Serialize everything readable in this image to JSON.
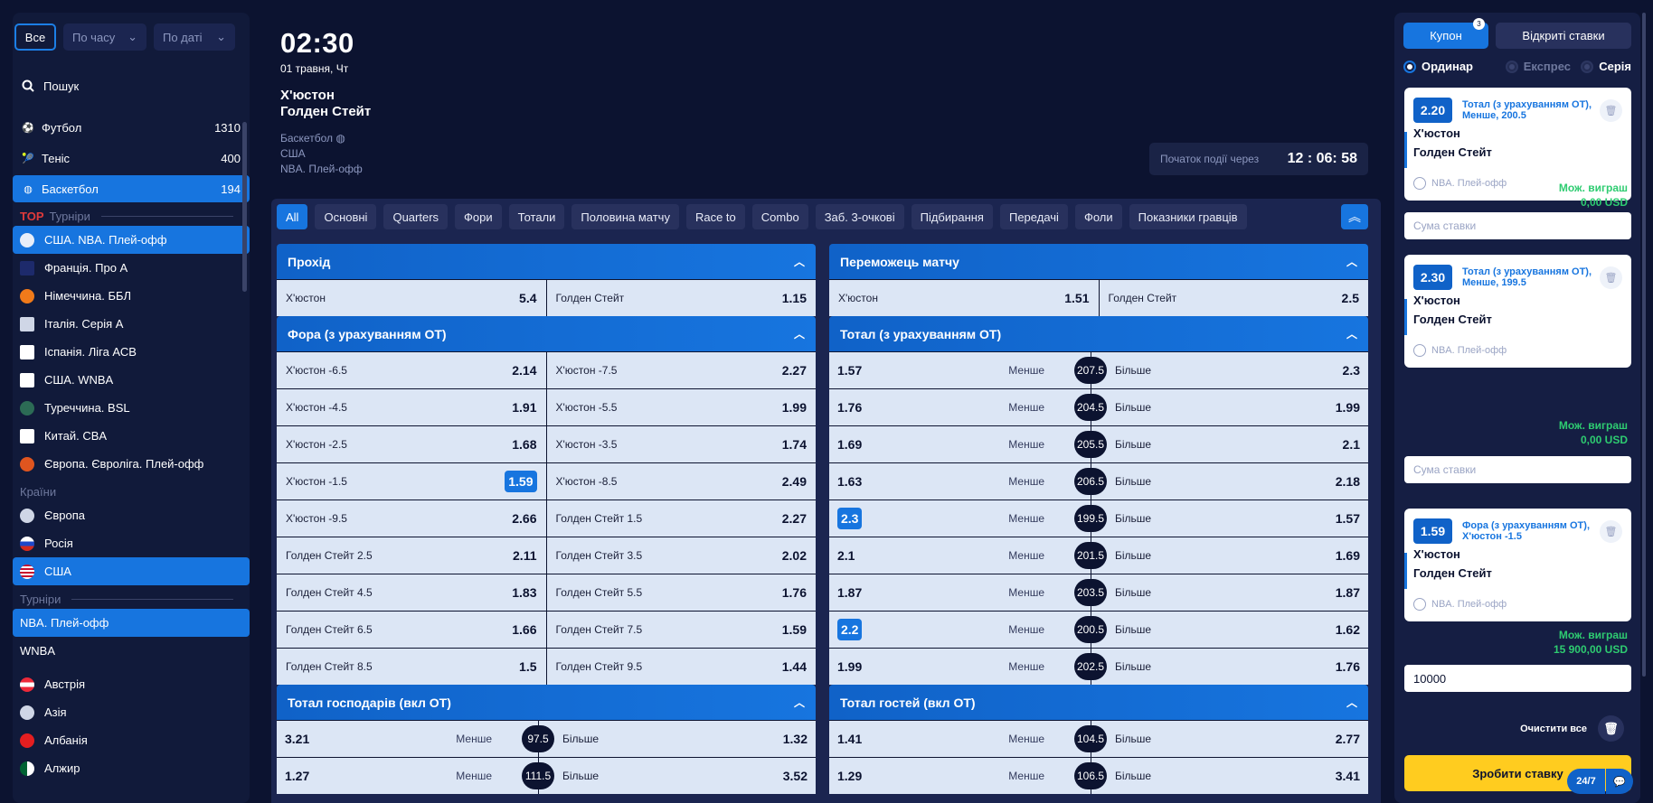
{
  "filters": {
    "all": "Все",
    "by_time": "По часу",
    "by_date": "По даті"
  },
  "search": {
    "label": "Пошук"
  },
  "sports": [
    {
      "icon": "football-icon",
      "name": "Футбол",
      "count": "1310"
    },
    {
      "icon": "tennis-icon",
      "name": "Теніс",
      "count": "400"
    },
    {
      "icon": "basketball-icon",
      "name": "Баскетбол",
      "count": "194"
    }
  ],
  "sections": {
    "top": "TOP",
    "tournaments": "Турніри",
    "countries": "Країни",
    "tournaments2": "Турніри"
  },
  "top_leagues": [
    "США. NBA. Плей-офф",
    "Франція. Про А",
    "Німеччина. ББЛ",
    "Італія. Серія А",
    "Іспанія. Ліга АСВ",
    "США. WNBA",
    "Туреччина. BSL",
    "Китай. CBA",
    "Європа. Євроліга. Плей-офф"
  ],
  "countries": [
    "Європа",
    "Росія",
    "США"
  ],
  "tournaments": [
    "NBA. Плей-офф",
    "WNBA"
  ],
  "other_countries": [
    "Австрія",
    "Азія",
    "Албанія",
    "Алжир"
  ],
  "event": {
    "time": "02:30",
    "date": "01 травня, Чт",
    "team1": "Х'юстон",
    "team2": "Голден Стейт",
    "sport": "Баскетбол",
    "country": "США",
    "league": "NBA. Плей-офф",
    "countdown_label": "Початок події через",
    "countdown": "12 : 06: 58"
  },
  "tabs": [
    "All",
    "Основні",
    "Quarters",
    "Фори",
    "Тотали",
    "Половина матчу",
    "Race to",
    "Combo",
    "Заб. 3-очкові",
    "Підбирання",
    "Передачі",
    "Фоли",
    "Показники гравців"
  ],
  "markets": {
    "prohid": {
      "title": "Прохід",
      "rows": [
        [
          "Х'юстон",
          "5.4",
          "Голден Стейт",
          "1.15"
        ]
      ]
    },
    "winner": {
      "title": "Переможець матчу",
      "rows": [
        [
          "Х'юстон",
          "1.51",
          "Голден Стейт",
          "2.5"
        ]
      ]
    },
    "handicap": {
      "title": "Фора (з урахуванням ОТ)",
      "rows": [
        [
          "Х'юстон -6.5",
          "2.14",
          "Х'юстон -7.5",
          "2.27"
        ],
        [
          "Х'юстон -4.5",
          "1.91",
          "Х'юстон -5.5",
          "1.99"
        ],
        [
          "Х'юстон -2.5",
          "1.68",
          "Х'юстон -3.5",
          "1.74"
        ],
        [
          "Х'юстон -1.5",
          "1.59",
          "Х'юстон -8.5",
          "2.49"
        ],
        [
          "Х'юстон -9.5",
          "2.66",
          "Голден Стейт 1.5",
          "2.27"
        ],
        [
          "Голден Стейт 2.5",
          "2.11",
          "Голден Стейт 3.5",
          "2.02"
        ],
        [
          "Голден Стейт 4.5",
          "1.83",
          "Голден Стейт 5.5",
          "1.76"
        ],
        [
          "Голден Стейт 6.5",
          "1.66",
          "Голден Стейт 7.5",
          "1.59"
        ],
        [
          "Голден Стейт 8.5",
          "1.5",
          "Голден Стейт 9.5",
          "1.44"
        ]
      ]
    },
    "total": {
      "title": "Тотал (з урахуванням ОТ)",
      "under": "Менше",
      "over": "Більше",
      "rows": [
        [
          "1.57",
          "207.5",
          "2.3"
        ],
        [
          "1.76",
          "204.5",
          "1.99"
        ],
        [
          "1.69",
          "205.5",
          "2.1"
        ],
        [
          "1.63",
          "206.5",
          "2.18"
        ],
        [
          "2.3",
          "199.5",
          "1.57"
        ],
        [
          "2.1",
          "201.5",
          "1.69"
        ],
        [
          "1.87",
          "203.5",
          "1.87"
        ],
        [
          "2.2",
          "200.5",
          "1.62"
        ],
        [
          "1.99",
          "202.5",
          "1.76"
        ]
      ]
    },
    "home_total": {
      "title": "Тотал господарів (вкл ОТ)",
      "under": "Менше",
      "over": "Більше",
      "rows": [
        [
          "3.21",
          "97.5",
          "1.32"
        ],
        [
          "1.27",
          "111.5",
          "3.52"
        ]
      ]
    },
    "away_total": {
      "title": "Тотал гостей (вкл ОТ)",
      "under": "Менше",
      "over": "Більше",
      "rows": [
        [
          "1.41",
          "104.5",
          "2.77"
        ],
        [
          "1.29",
          "106.5",
          "3.41"
        ]
      ]
    }
  },
  "coupon": {
    "tab_coupon": "Купон",
    "badge": "3",
    "tab_open": "Відкриті ставки",
    "types": [
      "Ординар",
      "Експрес",
      "Серія"
    ],
    "bets": [
      {
        "odd": "2.20",
        "desc": "Тотал (з урахуванням ОТ), Менше, 200.5",
        "team1": "Х'юстон",
        "team2": "Голден Стейт",
        "league": "NBA. Плей-офф",
        "win_label": "Мож. виграш",
        "win": "0,00 USD",
        "stake": "",
        "placeholder": "Сума ставки"
      },
      {
        "odd": "2.30",
        "desc": "Тотал (з урахуванням ОТ), Менше, 199.5",
        "team1": "Х'юстон",
        "team2": "Голден Стейт",
        "league": "NBA. Плей-офф",
        "win_label": "Мож. виграш",
        "win": "0,00 USD",
        "stake": "",
        "placeholder": "Сума ставки"
      },
      {
        "odd": "1.59",
        "desc": "Фора (з урахуванням ОТ), Х'юстон -1.5",
        "team1": "Х'юстон",
        "team2": "Голден Стейт",
        "league": "NBA. Плей-офф",
        "win_label": "Мож. виграш",
        "win": "15 900,00 USD",
        "stake": "10000",
        "placeholder": "Сума ставки"
      }
    ],
    "clear": "Очистити все",
    "submit": "Зробити ставку",
    "support": "24/7"
  }
}
